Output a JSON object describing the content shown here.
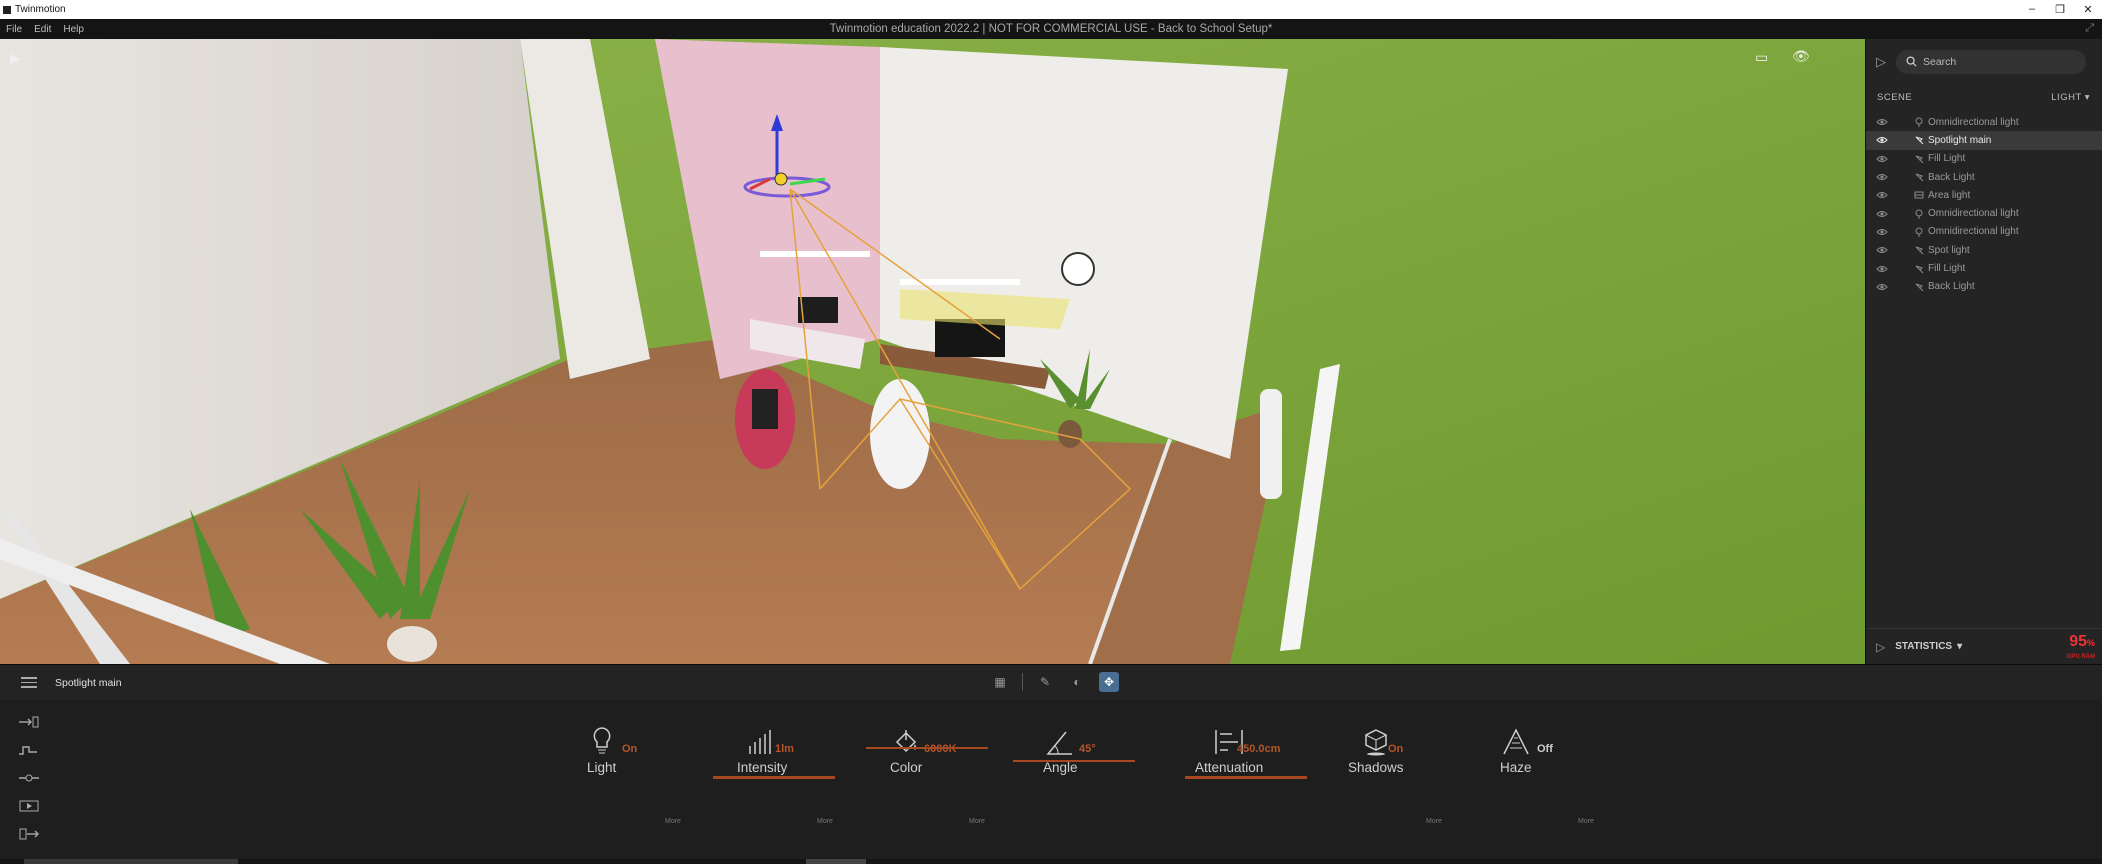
{
  "os": {
    "app_name": "Twinmotion",
    "minimize": "–",
    "restore": "❐",
    "close": "✕"
  },
  "menu": {
    "items": [
      "File",
      "Edit",
      "Help"
    ],
    "title": "Twinmotion education 2022.2 | NOT FOR COMMERCIAL USE - Back to School Setup*"
  },
  "viewport": {
    "icons": [
      "play-icon",
      "frame-icon",
      "eye-icon"
    ]
  },
  "right_panel": {
    "search_placeholder": "Search",
    "scene_label": "SCENE",
    "filter_label": "LIGHT",
    "items": [
      {
        "label": "Omnidirectional light",
        "type": "omni",
        "selected": false
      },
      {
        "label": "Spotlight main",
        "type": "spot",
        "selected": true
      },
      {
        "label": "Fill Light",
        "type": "spot",
        "selected": false
      },
      {
        "label": "Back Light",
        "type": "spot",
        "selected": false
      },
      {
        "label": "Area light",
        "type": "area",
        "selected": false
      },
      {
        "label": "Omnidirectional light",
        "type": "omni",
        "selected": false
      },
      {
        "label": "Omnidirectional light",
        "type": "omni",
        "selected": false
      },
      {
        "label": "Spot light",
        "type": "spot",
        "selected": false
      },
      {
        "label": "Fill Light",
        "type": "spot",
        "selected": false
      },
      {
        "label": "Back Light",
        "type": "spot",
        "selected": false
      }
    ],
    "statistics_label": "STATISTICS",
    "fps_value": "95",
    "fps_unit": "%",
    "fps_sub": "GPU RAM"
  },
  "bottom_panel": {
    "selected_name": "Spotlight main",
    "properties": [
      {
        "key": "light",
        "label": "Light",
        "value": "On"
      },
      {
        "key": "intensity",
        "label": "Intensity",
        "value": "1lm"
      },
      {
        "key": "color",
        "label": "Color",
        "value": "6000K"
      },
      {
        "key": "angle",
        "label": "Angle",
        "value": "45°"
      },
      {
        "key": "attenuation",
        "label": "Attenuation",
        "value": "450.0cm"
      },
      {
        "key": "shadows",
        "label": "Shadows",
        "value": "On"
      },
      {
        "key": "haze",
        "label": "Haze",
        "value": "Off"
      }
    ],
    "more_label": "More"
  }
}
